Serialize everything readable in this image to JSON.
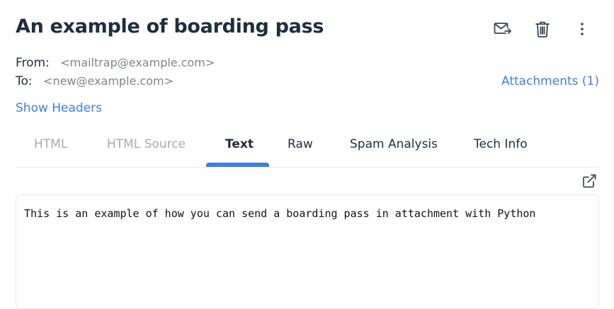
{
  "email": {
    "subject": "An example of boarding pass",
    "from_label": "From:",
    "from_value": "<mailtrap@example.com>",
    "to_label": "To:",
    "to_value": "<new@example.com>",
    "attachments_label": "Attachments (1)",
    "show_headers_label": "Show Headers",
    "body_text": "This is an example of how you can send a boarding pass in attachment with Python"
  },
  "actions": {
    "icons": [
      "forward-email-icon",
      "trash-icon",
      "more-vertical-icon"
    ]
  },
  "tabs": [
    {
      "label": "HTML",
      "state": "disabled"
    },
    {
      "label": "HTML Source",
      "state": "disabled"
    },
    {
      "label": "Text",
      "state": "active"
    },
    {
      "label": "Raw",
      "state": "normal"
    },
    {
      "label": "Spam Analysis",
      "state": "normal"
    },
    {
      "label": "Tech Info",
      "state": "normal"
    }
  ],
  "colors": {
    "accent": "#3d7fe0",
    "heading": "#1f2d3d",
    "muted": "#7f858c",
    "disabled": "#a7abb0",
    "border": "#e4e7eb"
  }
}
